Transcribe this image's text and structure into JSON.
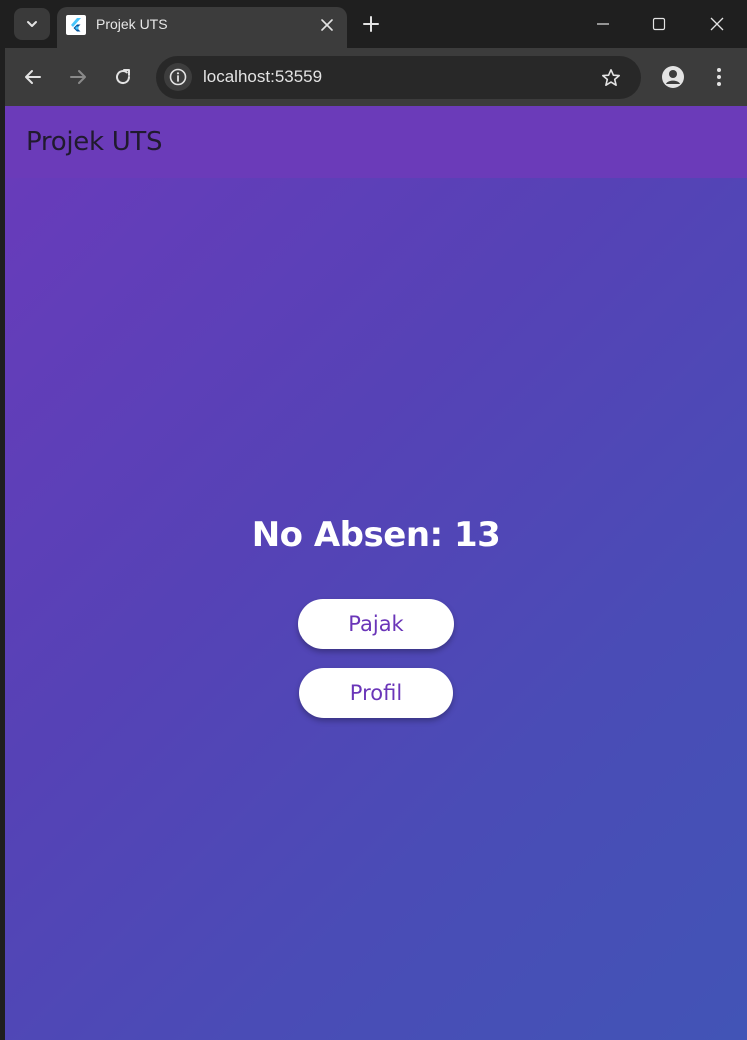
{
  "browser": {
    "tab_title": "Projek UTS",
    "url": "localhost:53559",
    "icons": {
      "tab_search": "chevron-down-icon",
      "favicon": "flutter-icon",
      "tab_close": "close-icon",
      "new_tab": "plus-icon",
      "minimize": "minimize-icon",
      "maximize": "maximize-icon",
      "close_window": "close-icon",
      "back": "arrow-left-icon",
      "forward": "arrow-right-icon",
      "reload": "reload-icon",
      "site_info": "info-icon",
      "bookmark": "star-icon",
      "profile": "person-icon",
      "menu": "more-vert-icon"
    }
  },
  "app": {
    "title": "Projek UTS",
    "absen_label": "No Absen: 13",
    "buttons": {
      "pajak": "Pajak",
      "profil": "Profil"
    },
    "colors": {
      "appbar": "#6b3bb9",
      "gradient_start": "#6a3bbb",
      "gradient_end": "#4254b6",
      "button_text": "#6a35b8",
      "button_bg": "#ffffff"
    }
  }
}
